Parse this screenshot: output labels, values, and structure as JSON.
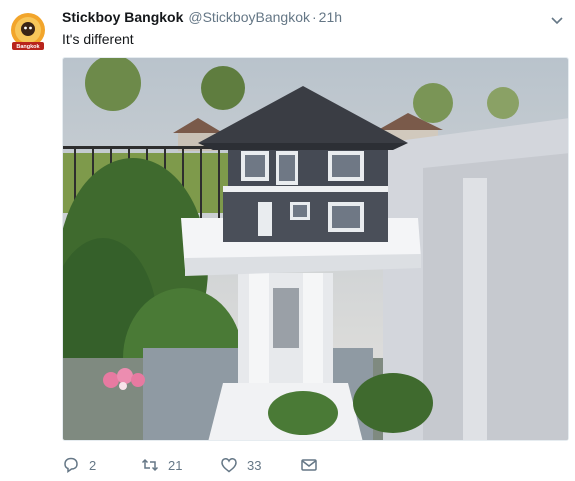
{
  "tweet": {
    "display_name": "Stickboy Bangkok",
    "handle": "@StickboyBangkok",
    "separator": "·",
    "time": "21h",
    "text": "It's different",
    "avatar_text": "Bangkok",
    "image_icon": "spirit-house-photo",
    "actions": {
      "reply_count": "2",
      "retweet_count": "21",
      "like_count": "33"
    }
  },
  "icons": {
    "reply": "reply-icon",
    "retweet": "retweet-icon",
    "like": "heart-icon",
    "dm": "envelope-icon",
    "caret": "chevron-down-icon"
  },
  "colors": {
    "text": "#14171a",
    "secondary": "#657786",
    "house_roof": "#3b3e45",
    "house_body": "#474b55",
    "wall": "#d6d8dd"
  }
}
